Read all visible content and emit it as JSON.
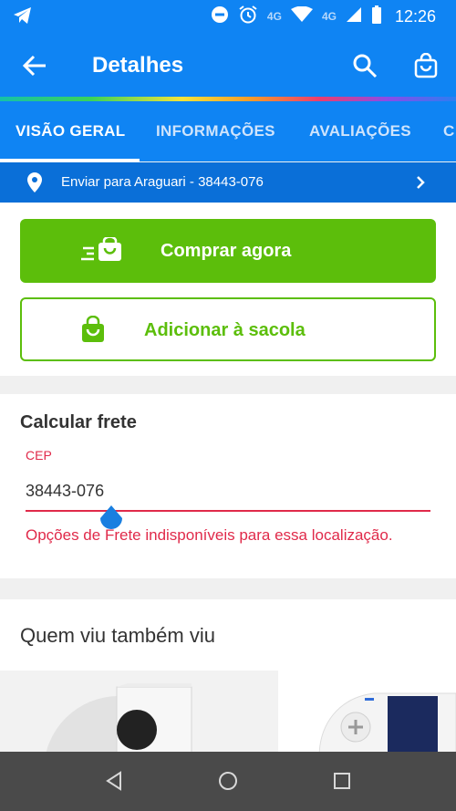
{
  "status_bar": {
    "time": "12:26",
    "network_label_1": "4G",
    "network_label_2": "4G",
    "icons": [
      "telegram-icon",
      "do-not-disturb-icon",
      "alarm-icon",
      "wifi-icon",
      "cell-signal-icon",
      "battery-icon"
    ]
  },
  "app_bar": {
    "title": "Detalhes",
    "icons": [
      "back-arrow-icon",
      "search-icon",
      "shopping-bag-icon"
    ]
  },
  "tabs": [
    {
      "label": "VISÃO GERAL",
      "active": true
    },
    {
      "label": "INFORMAÇÕES",
      "active": false
    },
    {
      "label": "AVALIAÇÕES",
      "active": false
    },
    {
      "label": "C",
      "active": false
    }
  ],
  "shipping": {
    "text": "Enviar para Araguari - 38443-076"
  },
  "actions": {
    "buy_now": "Comprar agora",
    "add_to_bag": "Adicionar à sacola"
  },
  "frete": {
    "title": "Calcular frete",
    "cep_label": "CEP",
    "cep_value": "38443-076",
    "error": "Opções de Frete indisponíveis para essa localização."
  },
  "recommendations": {
    "title": "Quem viu também viu"
  },
  "colors": {
    "primary_blue": "#0f84f3",
    "dark_blue": "#0a6fd8",
    "green": "#5cbe0b",
    "error_red": "#e02a4a"
  }
}
